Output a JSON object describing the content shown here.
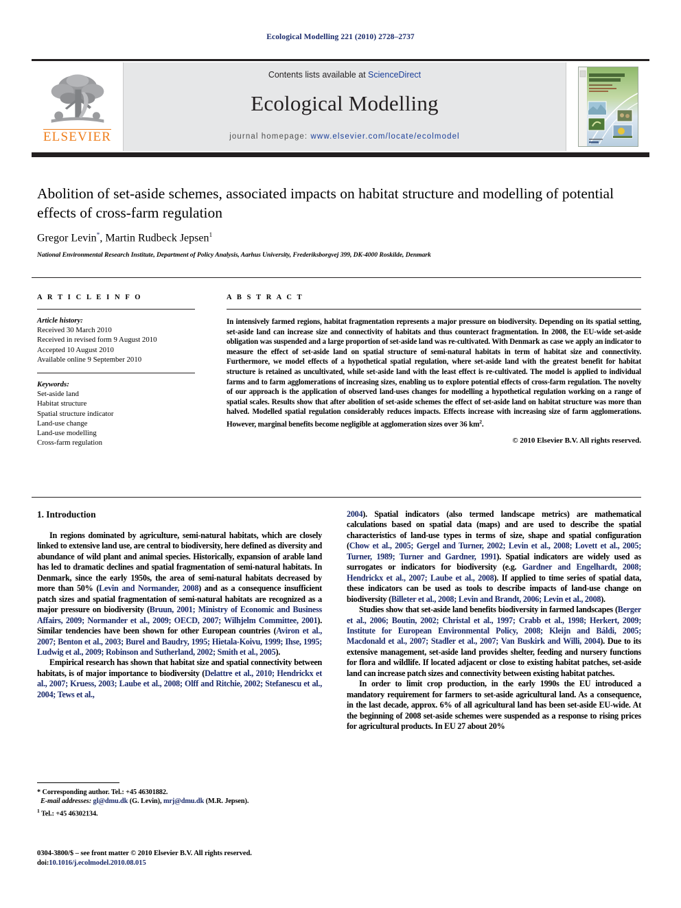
{
  "running_head": "Ecological Modelling 221 (2010) 2728–2737",
  "masthead": {
    "contents_prefix": "Contents lists available at ",
    "sciencedirect": "ScienceDirect",
    "journal_title": "Ecological Modelling",
    "homepage_prefix": "journal homepage:",
    "homepage_url": "www.elsevier.com/locate/ecolmodel",
    "publisher_name": "ELSEVIER",
    "cover_title_line1": "ECOLOGICAL",
    "cover_title_line2": "MODELLING",
    "cover_subtitle": "An International Journal",
    "colors": {
      "elsevier_orange": "#ef7d1a",
      "link_blue": "#1a3e99",
      "panel_gray": "#e6e7e8",
      "rule_black": "#231f20"
    }
  },
  "title": "Abolition of set-aside schemes, associated impacts on habitat structure and modelling of potential effects of cross-farm regulation",
  "authors_html": "Gregor Levin<sup class=\"star\">*</sup>, Martin Rudbeck Jepsen<sup>1</sup>",
  "authors_plain": "Gregor Levin*, Martin Rudbeck Jepsen1",
  "affiliation": "National Environmental Research Institute, Department of Policy Analysis, Aarhus University, Frederiksborgvej 399, DK-4000 Roskilde, Denmark",
  "article_info": {
    "heading": "A R T I C L E  I N F O",
    "history_label": "Article history:",
    "history": [
      "Received 30 March 2010",
      "Received in revised form 9 August 2010",
      "Accepted 10 August 2010",
      "Available online 9 September 2010"
    ],
    "keywords_label": "Keywords:",
    "keywords": [
      "Set-aside land",
      "Habitat structure",
      "Spatial structure indicator",
      "Land-use change",
      "Land-use modelling",
      "Cross-farm regulation"
    ]
  },
  "abstract": {
    "heading": "A B S T R A C T",
    "text_part1": "In intensively farmed regions, habitat fragmentation represents a major pressure on biodiversity. Depending on its spatial setting, set-aside land can increase size and connectivity of habitats and thus counteract fragmentation. In 2008, the EU-wide set-aside obligation was suspended and a large proportion of set-aside land was re-cultivated. With Denmark as case we apply an indicator to measure the effect of set-aside land on spatial structure of semi-natural habitats in term of habitat size and connectivity. Furthermore, we model effects of a hypothetical spatial regulation, where set-aside land with the greatest benefit for habitat structure is retained as uncultivated, while set-aside land with the least effect is re-cultivated. The model is applied to individual farms and to farm agglomerations of increasing sizes, enabling us to explore potential effects of cross-farm regulation. The novelty of our approach is the application of observed land-uses changes for modelling a hypothetical regulation working on a range of spatial scales. Results show that after abolition of set-aside schemes the effect of set-aside land on habitat structure was more than halved. Modelled spatial regulation considerably reduces impacts. Effects increase with increasing size of farm agglomerations. However, marginal benefits become negligible at agglomeration sizes over 36",
    "unit_km": "km",
    "unit_sup": "2",
    "text_part2": ".",
    "copyright": "© 2010 Elsevier B.V. All rights reserved."
  },
  "body": {
    "section_heading": "1. Introduction",
    "left_paragraphs": [
      {
        "id": "p1",
        "segments": [
          {
            "t": "In regions dominated by agriculture, semi-natural habitats, which are closely linked to extensive land use, are central to biodiversity, here defined as diversity and abundance of wild plant and animal species. Historically, expansion of arable land has led to dramatic declines and spatial fragmentation of semi-natural habitats. In Denmark, since the early 1950s, the area of semi-natural habitats decreased by more than 50% (",
            "k": "plain"
          },
          {
            "t": "Levin and Normander, 2008",
            "k": "cite"
          },
          {
            "t": ") and as a consequence insufficient patch sizes and spatial fragmentation of semi-natural habitats are recognized as a major pressure on biodiversity (",
            "k": "plain"
          },
          {
            "t": "Bruun, 2001; Ministry of Economic and Business Affairs, 2009; Normander et al., 2009; OECD, 2007; Wilhjelm Committee, 2001",
            "k": "cite"
          },
          {
            "t": "). Similar tendencies have been shown for other European countries (",
            "k": "plain"
          },
          {
            "t": "Aviron et al., 2007; Benton et al., 2003; Burel and Baudry, 1995; Hietala-Koivu, 1999; Ihse, 1995; Ludwig et al., 2009; Robinson and Sutherland, 2002; Smith et al., 2005",
            "k": "cite"
          },
          {
            "t": ").",
            "k": "plain"
          }
        ]
      },
      {
        "id": "p2",
        "segments": [
          {
            "t": "Empirical research has shown that habitat size and spatial connectivity between habitats, is of major importance to biodiversity (",
            "k": "plain"
          },
          {
            "t": "Delattre et al., 2010; Hendrickx et al., 2007; Kruess, 2003; Laube et al., 2008; Olff and Ritchie, 2002; Stefanescu et al., 2004; Tews et al.,",
            "k": "cite"
          }
        ]
      }
    ],
    "right_paragraphs": [
      {
        "id": "p3",
        "segments": [
          {
            "t": "2004",
            "k": "cite"
          },
          {
            "t": "). Spatial indicators (also termed landscape metrics) are mathematical calculations based on spatial data (maps) and are used to describe the spatial characteristics of land-use types in terms of size, shape and spatial configuration (",
            "k": "plain"
          },
          {
            "t": "Chow et al., 2005; Gergel and Turner, 2002; Levin et al., 2008; Lovett et al., 2005; Turner, 1989; Turner and Gardner, 1991",
            "k": "cite"
          },
          {
            "t": "). Spatial indicators are widely used as surrogates or indicators for biodiversity (e.g. ",
            "k": "plain"
          },
          {
            "t": "Gardner and Engelhardt, 2008; Hendrickx et al., 2007; Laube et al., 2008",
            "k": "cite"
          },
          {
            "t": "). If applied to time series of spatial data, these indicators can be used as tools to describe impacts of land-use change on biodiversity (",
            "k": "plain"
          },
          {
            "t": "Billeter et al., 2008; Levin and Brandt, 2006; Levin et al., 2008",
            "k": "cite"
          },
          {
            "t": ").",
            "k": "plain"
          }
        ]
      },
      {
        "id": "p4",
        "segments": [
          {
            "t": "Studies show that set-aside land benefits biodiversity in farmed landscapes (",
            "k": "plain"
          },
          {
            "t": "Berger et al., 2006; Boutin, 2002; Christal et al., 1997; Crabb et al., 1998; Herkert, 2009; Institute for European Environmental Policy, 2008; Kleijn and Báldi, 2005; Macdonald et al., 2007; Stadler et al., 2007; Van Buskirk and Willi, 2004",
            "k": "cite"
          },
          {
            "t": "). Due to its extensive management, set-aside land provides shelter, feeding and nursery functions for flora and wildlife. If located adjacent or close to existing habitat patches, set-aside land can increase patch sizes and connectivity between existing habitat patches.",
            "k": "plain"
          }
        ]
      },
      {
        "id": "p5",
        "segments": [
          {
            "t": "In order to limit crop production, in the early 1990s the EU introduced a mandatory requirement for farmers to set-aside agricultural land. As a consequence, in the last decade, approx. 6% of all agricultural land has been set-aside EU-wide. At the beginning of 2008 set-aside schemes were suspended as a response to rising prices for agricultural products. In EU 27 about 20%",
            "k": "plain"
          }
        ]
      }
    ]
  },
  "footnotes": {
    "corresponding": "* Corresponding author. Tel.: +45 46301882.",
    "email_label": "E-mail addresses:",
    "email1": "gl@dmu.dk",
    "email1_name": "(G. Levin),",
    "email2": "mrj@dmu.dk",
    "email2_name": "(M.R. Jepsen).",
    "tel_marker": "1",
    "tel": "Tel.: +45 46302134."
  },
  "imprint": {
    "line1": "0304-3800/$ – see front matter © 2010 Elsevier B.V. All rights reserved.",
    "doi_label": "doi:",
    "doi": "10.1016/j.ecolmodel.2010.08.015"
  }
}
